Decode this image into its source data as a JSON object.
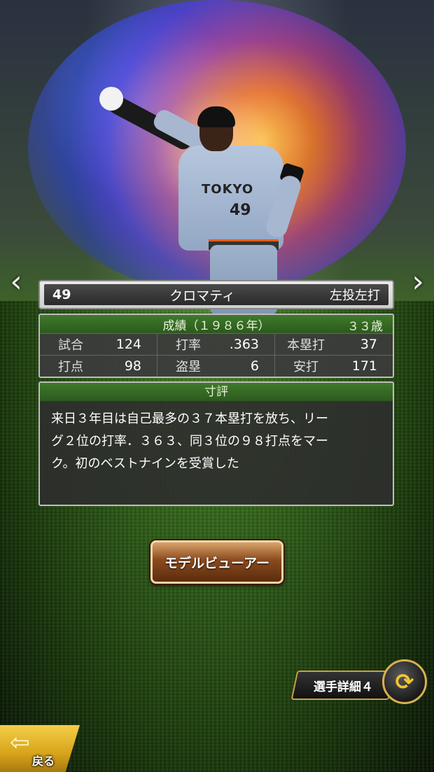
{
  "player": {
    "number": "49",
    "name": "クロマティ",
    "handedness": "左投左打",
    "jersey_text": "TOKYO",
    "jersey_number": "49"
  },
  "stats": {
    "season_label": "成績（１９８６年）",
    "age": "３３歳",
    "rows": [
      [
        {
          "label": "試合",
          "value": "124"
        },
        {
          "label": "打率",
          "value": ".363"
        },
        {
          "label": "本塁打",
          "value": "37"
        }
      ],
      [
        {
          "label": "打点",
          "value": "98"
        },
        {
          "label": "盗塁",
          "value": "6"
        },
        {
          "label": "安打",
          "value": "171"
        }
      ]
    ]
  },
  "comment": {
    "title": "寸評",
    "lines": [
      "来日３年目は自己最多の３７本塁打を放ち、リー",
      "グ２位の打率．３６３、同３位の９８打点をマー",
      "ク。初のベストナインを受賞した"
    ]
  },
  "buttons": {
    "model_viewer": "モデルビューアー",
    "player_details": "選手詳細４",
    "back": "戻る"
  },
  "icons": {
    "prev": "chevron-left-icon",
    "next": "chevron-right-icon",
    "swap": "swap-arrows-icon",
    "back": "back-arrow-icon"
  },
  "colors": {
    "section_header": "#2c5a1d",
    "button_brown": "#8a4a1e",
    "gold": "#d8b050"
  }
}
